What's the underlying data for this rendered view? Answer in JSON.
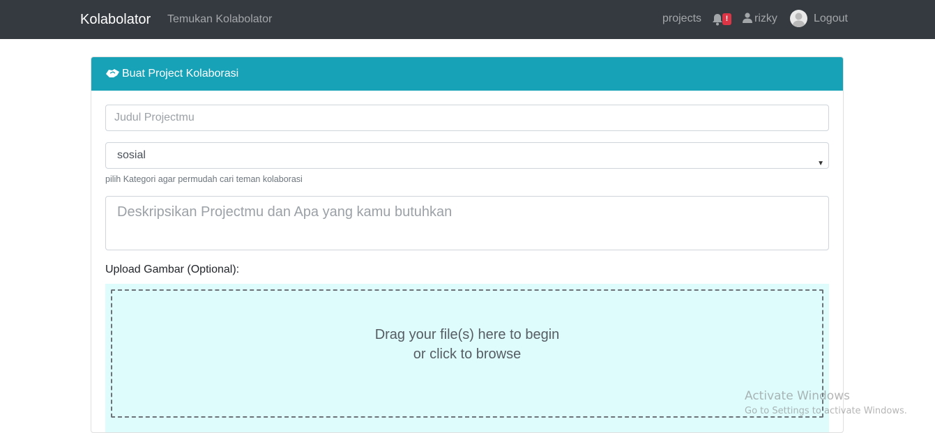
{
  "navbar": {
    "brand": "Kolabolator",
    "find_link": "Temukan Kolabolator",
    "projects_link": "projects",
    "notification_badge": "!",
    "username": "rizky",
    "logout_link": "Logout"
  },
  "card": {
    "title": "Buat Project Kolaborasi",
    "header_color": "#17a2b8"
  },
  "form": {
    "title_placeholder": "Judul Projectmu",
    "title_value": "",
    "category_selected": "sosial",
    "category_help": "pilih Kategori agar permudah cari teman kolaborasi",
    "description_placeholder": "Deskripsikan Projectmu dan Apa yang kamu butuhkan",
    "description_value": "",
    "upload_label": "Upload Gambar (Optional):",
    "dropzone_line1": "Drag your file(s) here to begin",
    "dropzone_line2": "or click to browse",
    "dropzone_color": "#dffcfd"
  },
  "watermark": {
    "line1": "Activate Windows",
    "line2": "Go to Settings to activate Windows."
  },
  "icons": {
    "brand_icon": "handshake-icon",
    "bell": "bell-icon",
    "user": "user-icon"
  }
}
